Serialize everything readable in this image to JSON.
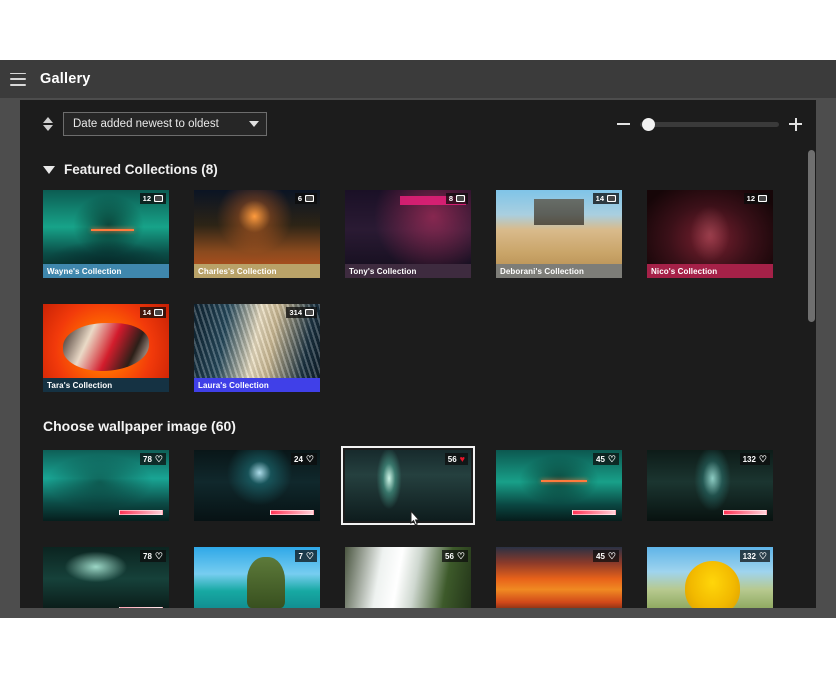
{
  "titlebar": {
    "menu_icon": "hamburger-icon",
    "title": "Gallery"
  },
  "toolbar": {
    "sort_icon": "sort-arrows-icon",
    "sort_value": "Date added newest to oldest",
    "dropdown_icon": "chevron-down-icon",
    "zoom_out_icon": "minus-icon",
    "zoom_in_icon": "plus-icon",
    "zoom_level": 4
  },
  "featured": {
    "collapse_icon": "triangle-down-icon",
    "heading": "Featured Collections (8)",
    "items": [
      {
        "name": "Wayne's Collection",
        "count": "12",
        "label_color": "#3f87ad",
        "art": "a-wayne"
      },
      {
        "name": "Charles's Collection",
        "count": "6",
        "label_color": "#b9a268",
        "art": "a-charles"
      },
      {
        "name": "Tony's Collection",
        "count": "8",
        "label_color": "#3e2b3f",
        "art": "a-tony"
      },
      {
        "name": "Deborani's Collection",
        "count": "14",
        "label_color": "#7d7d78",
        "art": "a-deborani"
      },
      {
        "name": "Nico's Collection",
        "count": "12",
        "label_color": "#a52148",
        "art": "a-nico"
      },
      {
        "name": "Tara's Collection",
        "count": "14",
        "label_color": "#153243",
        "art": "a-tara"
      },
      {
        "name": "Laura's Collection",
        "count": "314",
        "label_color": "#4040e8",
        "art": "a-laura"
      }
    ]
  },
  "wallpapers": {
    "heading": "Choose wallpaper image (60)",
    "items": [
      {
        "likes": "78",
        "liked": false,
        "selected": false,
        "art": "a-wp1",
        "hud": true
      },
      {
        "likes": "24",
        "liked": false,
        "selected": false,
        "art": "a-wp2",
        "hud": true
      },
      {
        "likes": "56",
        "liked": true,
        "selected": true,
        "art": "a-wp3",
        "hud": false
      },
      {
        "likes": "45",
        "liked": false,
        "selected": false,
        "art": "a-wp4",
        "hud": true
      },
      {
        "likes": "132",
        "liked": false,
        "selected": false,
        "art": "a-wp5",
        "hud": true
      },
      {
        "likes": "78",
        "liked": false,
        "selected": false,
        "art": "a-wp6",
        "hud": true
      },
      {
        "likes": "7",
        "liked": false,
        "selected": false,
        "art": "a-wp7",
        "hud": false
      },
      {
        "likes": "56",
        "liked": false,
        "selected": false,
        "art": "a-wp8",
        "hud": false
      },
      {
        "likes": "45",
        "liked": false,
        "selected": false,
        "art": "a-wp9",
        "hud": false
      },
      {
        "likes": "132",
        "liked": false,
        "selected": false,
        "art": "a-wp10",
        "hud": false
      }
    ]
  },
  "scrollbar": {
    "icon": "vertical-scrollbar"
  },
  "cursor": {
    "icon": "pointer-cursor"
  }
}
